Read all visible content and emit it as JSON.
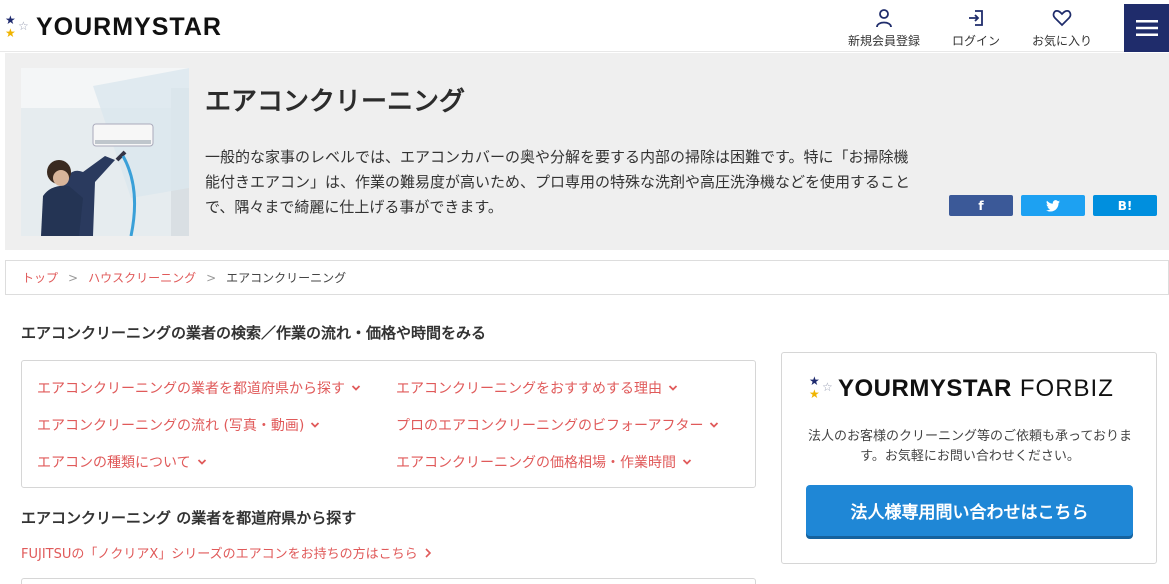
{
  "header": {
    "logo_text": "YOURMYSTAR",
    "nav": [
      {
        "label": "新規会員登録",
        "icon": "user-icon"
      },
      {
        "label": "ログイン",
        "icon": "login-icon"
      },
      {
        "label": "お気に入り",
        "icon": "heart-icon"
      }
    ],
    "menu_icon": "hamburger-icon",
    "menu_color": "#1f2c6b"
  },
  "hero": {
    "title": "エアコンクリーニング",
    "description": "一般的な家事のレベルでは、エアコンカバーの奥や分解を要する内部の掃除は困難です。特に「お掃除機能付きエアコン」は、作業の難易度が高いため、プロ専用の特殊な洗剤や高圧洗浄機などを使用することで、隅々まで綺麗に仕上げる事ができます。",
    "share": [
      {
        "label": "f",
        "icon": "facebook-icon",
        "color": "#3b5998"
      },
      {
        "label": "",
        "icon": "twitter-icon",
        "color": "#1da1f2"
      },
      {
        "label": "B!",
        "icon": "hatena-icon",
        "color": "#008fde"
      }
    ]
  },
  "breadcrumb": {
    "items": [
      "トップ",
      "ハウスクリーニング"
    ],
    "separator": ">",
    "current": "エアコンクリーニング"
  },
  "main": {
    "section_title": "エアコンクリーニングの業者の検索／作業の流れ・価格や時間をみる",
    "links": [
      "エアコンクリーニングの業者を都道府県から探す",
      "エアコンクリーニングをおすすめする理由",
      "エアコンクリーニングの流れ (写真・動画)",
      "プロのエアコンクリーニングのビフォーアフター",
      "エアコンの種類について",
      "エアコンクリーニングの価格相場・作業時間"
    ],
    "prefecture_title": "エアコンクリーニング の業者を都道府県から探す",
    "fujitsu_link": "FUJITSUの「ノクリアX」シリーズのエアコンをお持ちの方はこちら",
    "link_color": "#e05a5a"
  },
  "side": {
    "logo_text": "YOURMYSTAR",
    "logo_sub": "FORBIZ",
    "description": "法人のお客様のクリーニング等のご依頼も承っております。お気軽にお問い合わせください。",
    "button_label": "法人様専用問い合わせはこちら",
    "button_color": "#1f87d6"
  }
}
